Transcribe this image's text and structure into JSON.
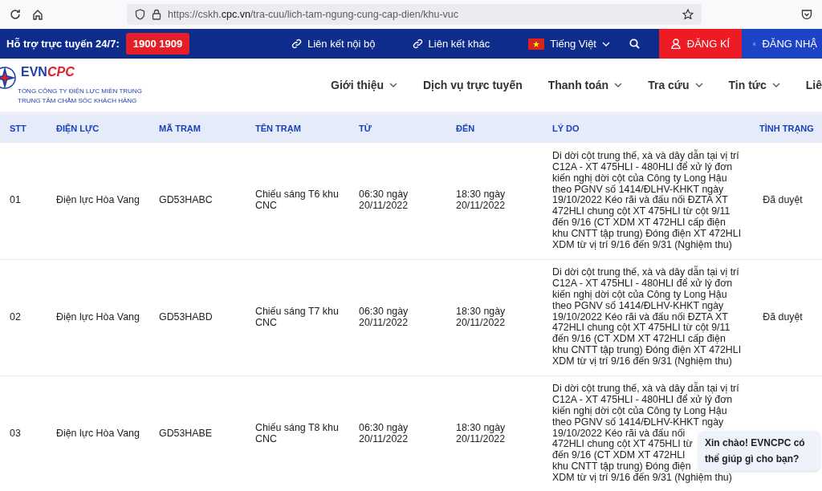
{
  "browser": {
    "url_host": "https://cskh.",
    "url_domain": "cpc.vn",
    "url_path": "/tra-cuu/lich-tam-ngung-cung-cap-dien/khu-vuc"
  },
  "topbar": {
    "support_label": "Hỗ trợ trực tuyến 24/7:",
    "hotline": "1900 1909",
    "links": [
      "Liên kết nội bộ",
      "Liên kết khác"
    ],
    "language": "Tiếng Việt",
    "register": "ĐĂNG KÍ",
    "login": "ĐĂNG NHẬ"
  },
  "logo": {
    "brand_a": "EVN",
    "brand_b": "CPC",
    "line1": "TỔNG CÔNG TY ĐIỆN LỰC MIỀN TRUNG",
    "line2": "TRUNG TÂM CHĂM SÓC KHÁCH HÀNG"
  },
  "nav": [
    {
      "label": "Giới thiệu",
      "dropdown": true
    },
    {
      "label": "Dịch vụ trực tuyến",
      "dropdown": false
    },
    {
      "label": "Thanh toán",
      "dropdown": true
    },
    {
      "label": "Tra cứu",
      "dropdown": true
    },
    {
      "label": "Tin tức",
      "dropdown": true
    },
    {
      "label": "Liê",
      "dropdown": false
    }
  ],
  "table": {
    "columns": [
      "STT",
      "ĐIỆN LỰC",
      "MÃ TRẠM",
      "TÊN TRẠM",
      "TỪ",
      "ĐẾN",
      "LÝ DO",
      "TÌNH TRẠNG"
    ],
    "rows": [
      [
        "01",
        "Điện lực Hòa Vang",
        "GD53HABC",
        "Chiếu sáng T6 khu CNC",
        "06:30 ngày 20/11/2022",
        "18:30 ngày 20/11/2022",
        "Di dời cột trung thế, xà và dây dẫn tại vị trí C12A - XT 475HLI - 480HLI để xử lý đơn kiến nghị dời cột của Công ty Long Hậu theo PGNV số 1414/ĐLHV-KHKT ngày 19/10/2022 Kéo rãi và đấu nối ĐZTA XT 472HLI chung cột XT 475HLI từ cột 9/11 đến 9/16 (CT XDM XT 472HLI cấp điện khu CNTT tập trung) Đóng điện XT 472HLI XDM từ vị trí 9/16 đến 9/31 (Nghiệm thu)",
        "Đã duyệt"
      ],
      [
        "02",
        "Điện lực Hòa Vang",
        "GD53HABD",
        "Chiếu sáng T7 khu CNC",
        "06:30 ngày 20/11/2022",
        "18:30 ngày 20/11/2022",
        "Di dời cột trung thế, xà và dây dẫn tại vị trí C12A - XT 475HLI - 480HLI để xử lý đơn kiến nghị dời cột của Công ty Long Hậu theo PGNV số 1414/ĐLHV-KHKT ngày 19/10/2022 Kéo rãi và đấu nối ĐZTA XT 472HLI chung cột XT 475HLI từ cột 9/11 đến 9/16 (CT XDM XT 472HLI cấp điện khu CNTT tập trung) Đóng điện XT 472HLI XDM từ vị trí 9/16 đến 9/31 (Nghiệm thu)",
        "Đã duyệt"
      ],
      [
        "03",
        "Điện lực Hòa Vang",
        "GD53HABE",
        "Chiếu sáng T8 khu CNC",
        "06:30 ngày 20/11/2022",
        "18:30 ngày 20/11/2022",
        "Di dời cột trung thế, xà và dây dẫn tại vị trí\nC12A - XT 475HLI - 480HLI để xử lý đơn\nkiến nghị dời cột của Công ty Long Hậu\ntheo PGNV số 1414/ĐLHV-KHKT ngày\n19/10/2022 Kéo rãi và đấu nối\n472HLI chung cột XT 475HLI từ\nđến 9/16 (CT XDM XT 472HLI\nkhu CNTT tập trung) Đóng điện\nXDM từ vị trí 9/16 đến 9/31 (Nghiệm thu)"
      ]
    ]
  },
  "chat": {
    "message": "Xin chào! EVNCPC có thể giúp gì cho bạn?"
  }
}
